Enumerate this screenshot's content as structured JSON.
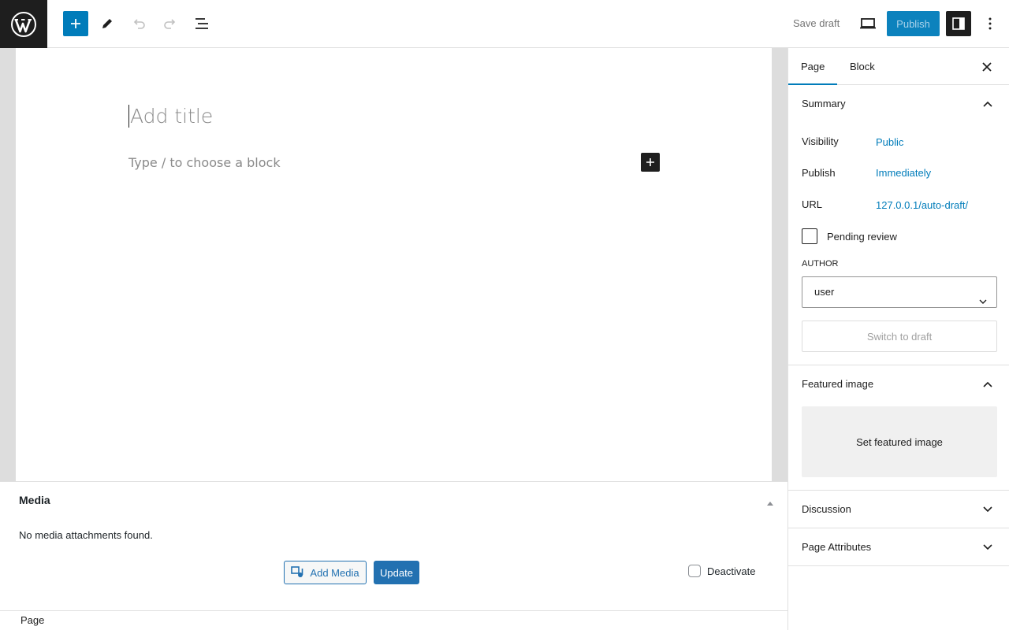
{
  "toolbar": {
    "save_draft_label": "Save draft",
    "publish_label": "Publish"
  },
  "editor": {
    "title_placeholder": "Add title",
    "block_placeholder": "Type / to choose a block"
  },
  "metabox": {
    "title": "Media",
    "empty_text": "No media attachments found.",
    "add_media_label": "Add Media",
    "update_label": "Update",
    "deactivate_label": "Deactivate"
  },
  "footer": {
    "breadcrumb": "Page"
  },
  "sidebar": {
    "tabs": [
      {
        "label": "Page"
      },
      {
        "label": "Block"
      }
    ],
    "summary": {
      "title": "Summary",
      "visibility_label": "Visibility",
      "visibility_value": "Public",
      "publish_label": "Publish",
      "publish_value": "Immediately",
      "url_label": "URL",
      "url_value": "127.0.0.1/auto-draft/",
      "pending_review_label": "Pending review",
      "author_label": "AUTHOR",
      "author_value": "user",
      "switch_to_draft_label": "Switch to draft"
    },
    "featured_image": {
      "title": "Featured image",
      "set_label": "Set featured image"
    },
    "discussion_title": "Discussion",
    "page_attributes_title": "Page Attributes"
  },
  "colors": {
    "accent": "#007cba",
    "dark": "#1e1e1e",
    "wp_admin_blue": "#2271b1"
  }
}
